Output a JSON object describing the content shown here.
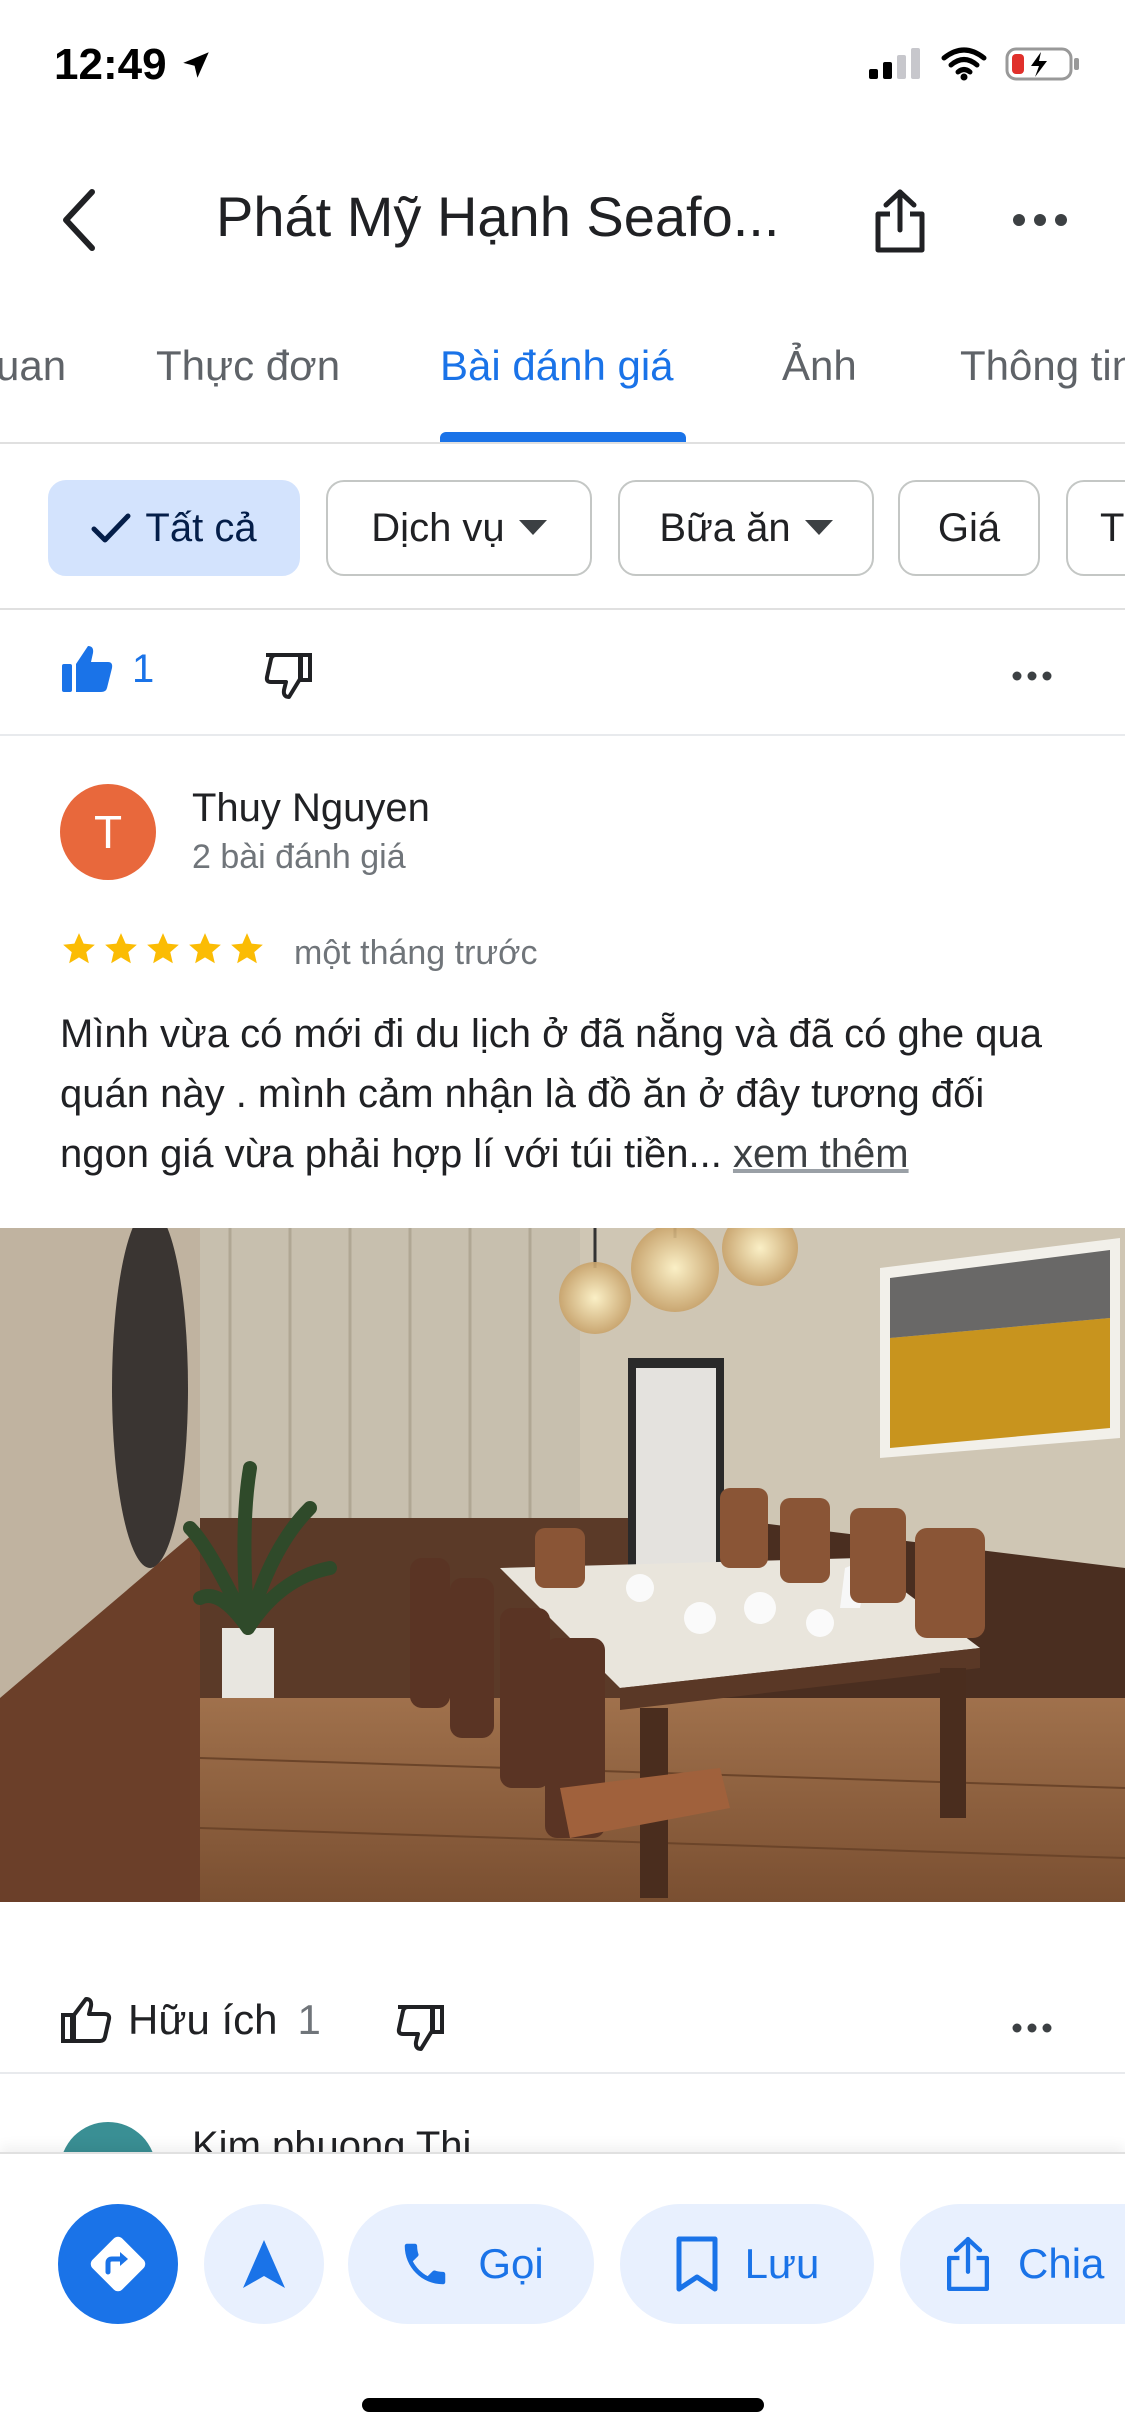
{
  "status_bar": {
    "time": "12:49"
  },
  "header": {
    "title": "Phát Mỹ Hạnh Seafo..."
  },
  "tabs": [
    {
      "label": "uan"
    },
    {
      "label": "Thực đơn"
    },
    {
      "label": "Bài đánh giá"
    },
    {
      "label": "Ảnh"
    },
    {
      "label": "Thông tin"
    }
  ],
  "filters": {
    "chips": [
      {
        "label": "Tất cả"
      },
      {
        "label": "Dịch vụ"
      },
      {
        "label": "Bữa ăn"
      },
      {
        "label": "Giá"
      },
      {
        "label": "T"
      }
    ]
  },
  "prev_review": {
    "like_count": "1"
  },
  "review": {
    "avatar_letter": "T",
    "name": "Thuy Nguyen",
    "subtitle": "2 bài đánh giá",
    "rating": 5,
    "time": "một tháng trước",
    "text": "Mình vừa có mới đi du lịch ở đã nẵng và đã có ghe qua quán này . mình cảm nhận là đồ ăn ở đây tương đối ngon giá vừa phải hợp lí với túi tiền...",
    "more_label": "xem thêm",
    "helpful_label": "Hữu ích",
    "helpful_count": "1"
  },
  "next_review": {
    "name": "Kim phuong Thi"
  },
  "bottom_bar": {
    "call_label": "Gọi",
    "save_label": "Lưu",
    "share_label": "Chia"
  },
  "colors": {
    "accent": "#1a73e8",
    "star": "#fbbc04",
    "chip_selected": "#d3e3fd"
  }
}
